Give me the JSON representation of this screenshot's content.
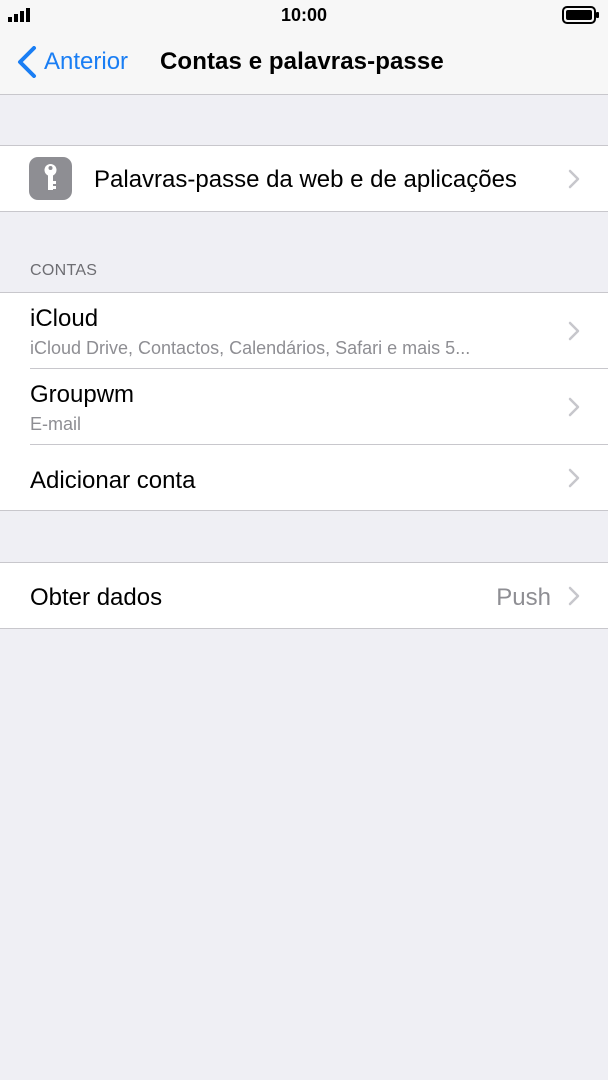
{
  "status_bar": {
    "time": "10:00"
  },
  "nav": {
    "back_label": "Anterior",
    "title": "Contas e palavras-passe"
  },
  "passwords_row": {
    "label": "Palavras-passe da web e de aplicações",
    "icon": "key-icon"
  },
  "accounts": {
    "header": "CONTAS",
    "items": [
      {
        "title": "iCloud",
        "subtitle": "iCloud Drive, Contactos, Calendários, Safari e mais 5..."
      },
      {
        "title": "Groupwm",
        "subtitle": "E-mail"
      },
      {
        "title": "Adicionar conta"
      }
    ]
  },
  "fetch": {
    "label": "Obter dados",
    "value": "Push"
  },
  "colors": {
    "accent": "#1a7ef4",
    "background": "#efeff4",
    "secondary_text": "#8e8e93"
  }
}
